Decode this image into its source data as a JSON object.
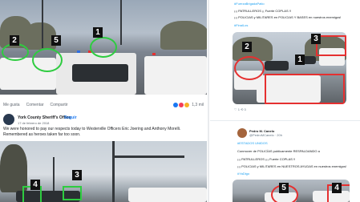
{
  "facebook": {
    "actions": {
      "like": "Me gusta",
      "comment": "Comentar",
      "share": "Compartir"
    },
    "reaction_count": "1,3 mil",
    "post": {
      "author": "York County Sheriff's Office",
      "follow": "Seguir",
      "date": "17 de febrero de 2018",
      "body": "We were honored to pay our respects today to Westerville Officers Eric Joering and Anthony Morelli. Remembered as heroes taken far too soon."
    },
    "markers_top": [
      "2",
      "5",
      "1"
    ],
    "markers_bottom": [
      "4",
      "3"
    ]
  },
  "twitter": {
    "tweet1": {
      "hashtag_top": "#FuerzaBrigadaPatio",
      "line1": "¡¡¡ PATRULLEROS ¡¡ Fuerte COPLAS !!",
      "line2": "¡¡¡ POLICIAS y MILITARES en POLICIAS Y BASES en nuestros enemigos!",
      "hashtag_bottom": "#FinalLos",
      "stats": "♡ 1  ⟲ 3"
    },
    "tweet2": {
      "author": "Pedro M. Canelo",
      "handle": "@PedroMCanelo · 20h",
      "line1": "#ESTADOS UNIDOS",
      "line2": "Conmover de POLICÍAS publicamente RESPALDANDO a",
      "line3": "¡¡¡ PATRULLEROS ¡¡¡ Fuerte COPLAS !!",
      "line4": "¡¡¡ POLICIAS y MILITARES en NUESTROS AYUDAS en nuestros enemigos!",
      "hashtag": "#YaDigo"
    },
    "markers_top": [
      "3",
      "2",
      "1"
    ],
    "markers_bottom": [
      "5",
      "4"
    ]
  },
  "colors": {
    "marker_green": "#2ecc40",
    "marker_red": "#e53030",
    "link_blue": "#1da1f2",
    "fb_blue": "#1877f2"
  }
}
